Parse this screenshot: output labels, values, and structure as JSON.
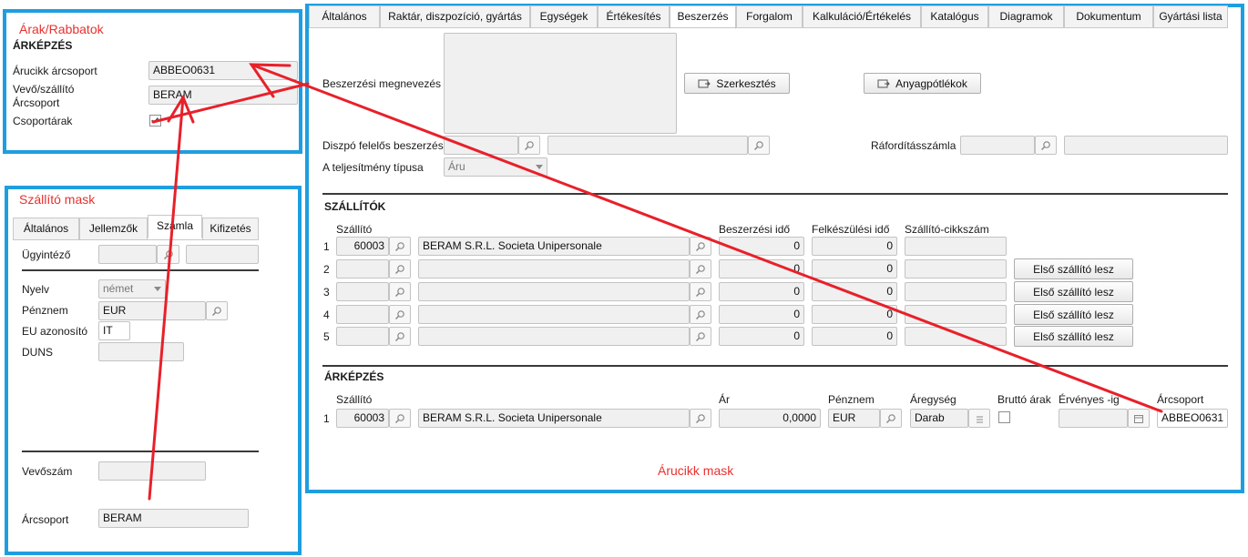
{
  "annotations": {
    "arak_title": "Árak/Rabbatok",
    "szallito_title": "Szállító mask",
    "arucikk_title": "Árucikk mask"
  },
  "arak_panel": {
    "heading": "ÁRKÉPZÉS",
    "arucikk_arcsoport_label": "Árucikk árcsoport",
    "arucikk_arcsoport_value": "ABBEO0631",
    "vevo_label_1": "Vevő/szállító",
    "vevo_label_2": "Árcsoport",
    "vevo_value": "BERAM",
    "csoportarak_label": "Csoportárak"
  },
  "supplier_panel": {
    "tabs": [
      "Általános",
      "Jellemzők",
      "Számla",
      "Kifizetés"
    ],
    "active_tab": "Számla",
    "ugyintezo_label": "Ügyintéző",
    "nyelv_label": "Nyelv",
    "nyelv_value": "német",
    "penznem_label": "Pénznem",
    "penznem_value": "EUR",
    "eu_label": "EU azonosító",
    "eu_value": "IT",
    "duns_label": "DUNS",
    "vevoszam_label": "Vevőszám",
    "arcsoport_label": "Árcsoport",
    "arcsoport_value": "BERAM"
  },
  "main_tabs": [
    "Általános",
    "Raktár, diszpozíció, gyártás",
    "Egységek",
    "Értékesítés",
    "Beszerzés",
    "Forgalom",
    "Kalkuláció/Értékelés",
    "Katalógus",
    "Diagramok",
    "Dokumentum",
    "Gyártási lista"
  ],
  "main": {
    "beszerzesi_megnevezes_label": "Beszerzési megnevezés",
    "szerkesztes_btn": "Szerkesztés",
    "anyagpotlekok_btn": "Anyagpótlékok",
    "dispo_label": "Diszpó felelős beszerzés",
    "raforditas_label": "Ráfordításszámla",
    "teljesitmeny_label": "A teljesítmény típusa",
    "teljesitmeny_value": "Áru",
    "szallitok_heading": "SZÁLLÍTÓK",
    "col_szallito": "Szállító",
    "col_beszerzesi_ido": "Beszerzési idő",
    "col_felkeszulesi_ido": "Felkészülési idő",
    "col_cikkszam": "Szállító-cikkszám",
    "first_supplier_btn": "Első szállító lesz",
    "rows": [
      {
        "n": "1",
        "code": "60003",
        "name": "BERAM S.R.L. Societa Unipersonale",
        "besz": "0",
        "felk": "0"
      },
      {
        "n": "2",
        "code": "",
        "name": "",
        "besz": "0",
        "felk": "0"
      },
      {
        "n": "3",
        "code": "",
        "name": "",
        "besz": "0",
        "felk": "0"
      },
      {
        "n": "4",
        "code": "",
        "name": "",
        "besz": "0",
        "felk": "0"
      },
      {
        "n": "5",
        "code": "",
        "name": "",
        "besz": "0",
        "felk": "0"
      }
    ],
    "arkepzes_heading": "ÁRKÉPZÉS",
    "price_cols": {
      "szallito": "Szállító",
      "ar": "Ár",
      "penznem": "Pénznem",
      "aregyseg": "Áregység",
      "brutto": "Bruttó árak",
      "ervenyes": "Érvényes -ig",
      "arcsoport": "Árcsoport"
    },
    "price_row": {
      "n": "1",
      "code": "60003",
      "name": "BERAM S.R.L. Societa Unipersonale",
      "ar": "0,0000",
      "penznem": "EUR",
      "aregyseg": "Darab",
      "arcsoport": "ABBEO0631"
    }
  }
}
